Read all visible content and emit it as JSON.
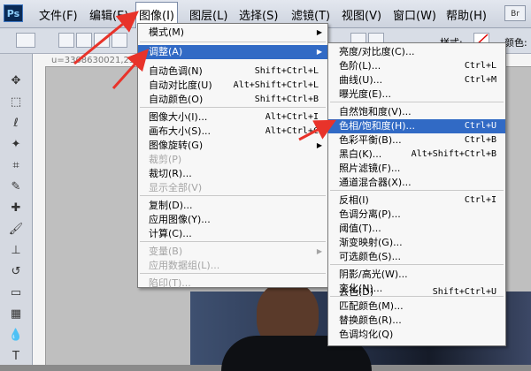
{
  "menubar": {
    "logo": "Ps",
    "items": [
      "文件(F)",
      "编辑(E)",
      "图像(I)",
      "图层(L)",
      "选择(S)",
      "滤镜(T)",
      "视图(V)",
      "窗口(W)",
      "帮助(H)"
    ],
    "bridge": "Br"
  },
  "optbar": {
    "style_label": "样式:",
    "color_label": "颜色:"
  },
  "ruler": {
    "coord": "u=3308630021,2340"
  },
  "image_menu": {
    "items": [
      {
        "label": "模式(M)",
        "shortcut": "",
        "submenu": true,
        "disabled": false
      },
      {
        "label": "调整(A)",
        "shortcut": "",
        "submenu": true,
        "disabled": false,
        "highlighted": true
      },
      {
        "label": "自动色调(N)",
        "shortcut": "Shift+Ctrl+L"
      },
      {
        "label": "自动对比度(U)",
        "shortcut": "Alt+Shift+Ctrl+L"
      },
      {
        "label": "自动颜色(O)",
        "shortcut": "Shift+Ctrl+B"
      },
      {
        "label": "图像大小(I)...",
        "shortcut": "Alt+Ctrl+I"
      },
      {
        "label": "画布大小(S)...",
        "shortcut": "Alt+Ctrl+C"
      },
      {
        "label": "图像旋转(G)",
        "shortcut": "",
        "submenu": true
      },
      {
        "label": "裁剪(P)",
        "shortcut": "",
        "disabled": true
      },
      {
        "label": "裁切(R)...",
        "shortcut": ""
      },
      {
        "label": "显示全部(V)",
        "shortcut": "",
        "disabled": true
      },
      {
        "label": "复制(D)...",
        "shortcut": ""
      },
      {
        "label": "应用图像(Y)...",
        "shortcut": ""
      },
      {
        "label": "计算(C)...",
        "shortcut": ""
      },
      {
        "label": "变量(B)",
        "shortcut": "",
        "submenu": true,
        "disabled": true
      },
      {
        "label": "应用数据组(L)...",
        "shortcut": "",
        "disabled": true
      },
      {
        "label": "陷印(T)...",
        "shortcut": "",
        "disabled": true
      }
    ]
  },
  "adjust_menu": {
    "items": [
      {
        "label": "亮度/对比度(C)...",
        "shortcut": ""
      },
      {
        "label": "色阶(L)...",
        "shortcut": "Ctrl+L"
      },
      {
        "label": "曲线(U)...",
        "shortcut": "Ctrl+M"
      },
      {
        "label": "曝光度(E)...",
        "shortcut": ""
      },
      {
        "label": "自然饱和度(V)...",
        "shortcut": ""
      },
      {
        "label": "色相/饱和度(H)...",
        "shortcut": "Ctrl+U",
        "highlighted": true
      },
      {
        "label": "色彩平衡(B)...",
        "shortcut": "Ctrl+B"
      },
      {
        "label": "黑白(K)...",
        "shortcut": "Alt+Shift+Ctrl+B"
      },
      {
        "label": "照片滤镜(F)...",
        "shortcut": ""
      },
      {
        "label": "通道混合器(X)...",
        "shortcut": ""
      },
      {
        "label": "反相(I)",
        "shortcut": "Ctrl+I"
      },
      {
        "label": "色调分离(P)...",
        "shortcut": ""
      },
      {
        "label": "阈值(T)...",
        "shortcut": ""
      },
      {
        "label": "渐变映射(G)...",
        "shortcut": ""
      },
      {
        "label": "可选颜色(S)...",
        "shortcut": ""
      },
      {
        "label": "阴影/高光(W)...",
        "shortcut": ""
      },
      {
        "label": "变化(N)...",
        "shortcut": ""
      },
      {
        "label": "去色(D)",
        "shortcut": "Shift+Ctrl+U"
      },
      {
        "label": "匹配颜色(M)...",
        "shortcut": ""
      },
      {
        "label": "替换颜色(R)...",
        "shortcut": ""
      },
      {
        "label": "色调均化(Q)",
        "shortcut": ""
      }
    ]
  },
  "colors": {
    "highlight": "#316ac5",
    "annotation_arrow": "#e8332a",
    "ps_logo_bg": "#0a2a55"
  }
}
